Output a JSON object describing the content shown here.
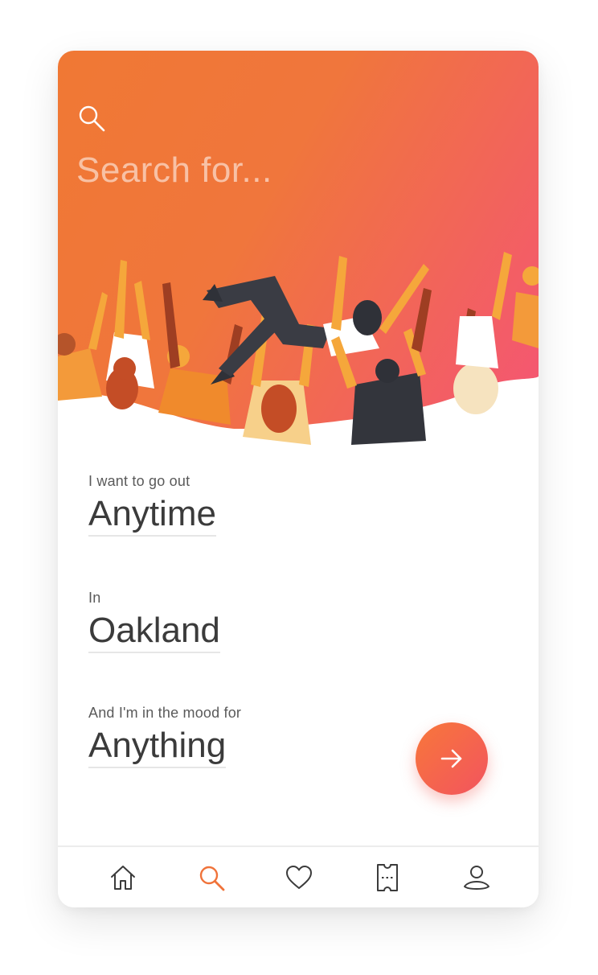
{
  "search": {
    "placeholder": "Search for...",
    "icon": "search-icon"
  },
  "form": {
    "when_label": "I want to go out",
    "when_value": "Anytime",
    "where_label": "In",
    "where_value": "Oakland",
    "mood_label": "And I'm in the mood for",
    "mood_value": "Anything"
  },
  "submit": {
    "icon": "arrow-right-icon"
  },
  "tabbar": {
    "items": [
      {
        "icon": "home-icon",
        "active": false
      },
      {
        "icon": "search-icon",
        "active": true
      },
      {
        "icon": "heart-icon",
        "active": false
      },
      {
        "icon": "ticket-icon",
        "active": false
      },
      {
        "icon": "profile-icon",
        "active": false
      }
    ]
  },
  "colors": {
    "gradient_start": "#f07834",
    "gradient_end": "#f45574",
    "accent": "#f0733a",
    "text_dark": "#3b3b3b",
    "text_label": "#5a5a5a"
  }
}
